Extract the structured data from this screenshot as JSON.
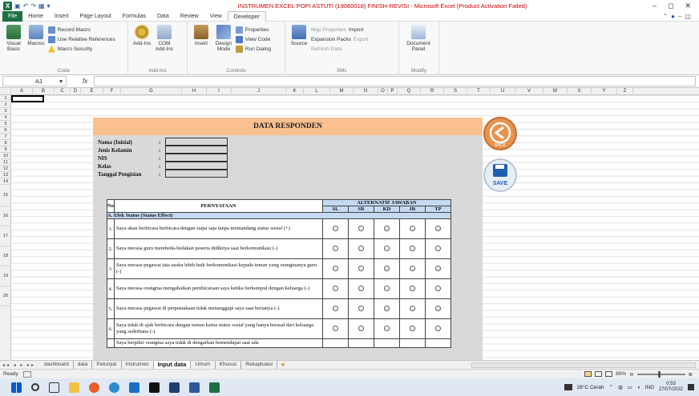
{
  "window": {
    "title": "INSTRUMEN EXCEL POPI ASTUTI (19080018) FINISH-REVISI  -  Microsoft Excel (Product Activation Failed)",
    "controls": [
      "–",
      "◻",
      "✕"
    ]
  },
  "menu": {
    "tabs": [
      "File",
      "Home",
      "Insert",
      "Page Layout",
      "Formulas",
      "Data",
      "Review",
      "View",
      "Developer"
    ],
    "active": "Developer"
  },
  "ribbon": {
    "code": {
      "label": "Code",
      "visual_basic": "Visual Basic",
      "macros": "Macros",
      "record_macro": "Record Macro",
      "use_relative": "Use Relative References",
      "macro_security": "Macro Security"
    },
    "addins": {
      "label": "Add-Ins",
      "addins": "Add-Ins",
      "com_addins": "COM Add-Ins"
    },
    "controls": {
      "label": "Controls",
      "insert": "Insert",
      "design_mode": "Design Mode",
      "properties": "Properties",
      "view_code": "View Code",
      "run_dialog": "Run Dialog"
    },
    "xml": {
      "label": "XML",
      "source": "Source",
      "map_properties": "Map Properties",
      "expansion_packs": "Expansion Packs",
      "refresh_data": "Refresh Data",
      "import": "Import",
      "export": "Export"
    },
    "modify": {
      "label": "Modify",
      "document_panel": "Document Panel"
    }
  },
  "formula_bar": {
    "name_box": "A1",
    "fx": "fx",
    "value": ""
  },
  "columns": [
    "A",
    "B",
    "C",
    "D",
    "E",
    "F",
    "G",
    "H",
    "I",
    "J",
    "K",
    "L",
    "M",
    "N",
    "O",
    "P",
    "Q",
    "R",
    "S",
    "T",
    "U",
    "V",
    "W",
    "X",
    "Y",
    "Z"
  ],
  "rows": [
    "1",
    "2",
    "3",
    "4",
    "5",
    "6",
    "7",
    "8",
    "9",
    "10",
    "11",
    "12",
    "13",
    "14",
    "15",
    "16",
    "17",
    "18",
    "19",
    "20"
  ],
  "form": {
    "title": "DATA RESPONDEN",
    "fields": [
      {
        "label": "Nama (Inisial)",
        "colon": ":"
      },
      {
        "label": "Jenis Kelamin",
        "colon": ":"
      },
      {
        "label": "NIS",
        "colon": ":"
      },
      {
        "label": "Kelas",
        "colon": ":"
      },
      {
        "label": "Tanggal Pengisian",
        "colon": ":"
      }
    ],
    "table": {
      "no_header": "No",
      "statement_header": "PERNYATAAN",
      "alt_header": "ALTERNATIF JAWABAN",
      "options": [
        "SL",
        "SR",
        "KD",
        "JR",
        "TP"
      ],
      "section": "A.  Efek Status (Status Effect)",
      "items": [
        {
          "no": "1.",
          "text": "Saya akan berbicara berbicara dengan siapa saja tanpa memandang status sosial (+)"
        },
        {
          "no": "2.",
          "text": "Saya merasa guru membeda-bedakan peserta didiknya saat berkomunikasi (-)"
        },
        {
          "no": "3.",
          "text": "Saya merasa pegawai tata usaha lebih baik berkomunikasi kepada teman yang orangtuanya guru (-)"
        },
        {
          "no": "4.",
          "text": "Saya merasa orangtua mengabaikan pembicaraan saya ketika berkumpul dengan keluarga (-)"
        },
        {
          "no": "5.",
          "text": "Saya merasa pegawai di perpustakaan tidak menanggapi saya saat bertanya (-)"
        },
        {
          "no": "6.",
          "text": "Saya tidak di ajak berbicara dengan teman karna status sosial yang hanya berasal dari keluarga yang sederhana (-)"
        },
        {
          "no": "",
          "text": "Saya berpikir orangtua saya tidak di dengarkan bemendapat saat ada"
        }
      ]
    },
    "back_label": "BACK",
    "save_label": "SAVE"
  },
  "sheet_tabs": [
    "dashboard",
    "data",
    "Petunjuk",
    "Instrumen",
    "Input data",
    "Umum",
    "Khusus",
    "Rekaptulasi"
  ],
  "active_sheet": "Input data",
  "status": {
    "ready": "Ready",
    "zoom": "80%"
  },
  "taskbar": {
    "weather": "28°C  Cerah",
    "lang": "IND",
    "time": "0:53",
    "date": "27/07/2022"
  },
  "colors": {
    "accent": "#1e7145",
    "form_header": "#fac090",
    "form_bg": "#d9d9d9",
    "table_header": "#c5d9f1",
    "title_red": "#c00000"
  }
}
